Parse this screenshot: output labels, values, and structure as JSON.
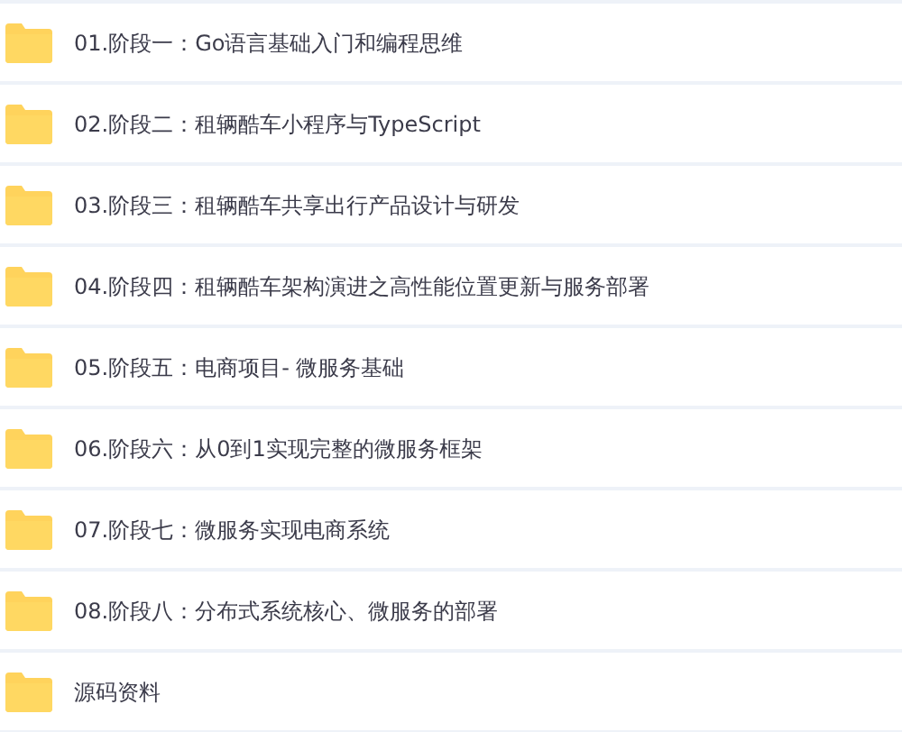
{
  "folders": [
    {
      "name": "01.阶段一：Go语言基础入门和编程思维"
    },
    {
      "name": "02.阶段二：租辆酷车小程序与TypeScript"
    },
    {
      "name": "03.阶段三：租辆酷车共享出行产品设计与研发"
    },
    {
      "name": "04.阶段四：租辆酷车架构演进之高性能位置更新与服务部署"
    },
    {
      "name": "05.阶段五：电商项目- 微服务基础"
    },
    {
      "name": "06.阶段六：从0到1实现完整的微服务框架"
    },
    {
      "name": "07.阶段七：微服务实现电商系统"
    },
    {
      "name": "08.阶段八：分布式系统核心、微服务的部署"
    },
    {
      "name": "源码资料"
    }
  ]
}
